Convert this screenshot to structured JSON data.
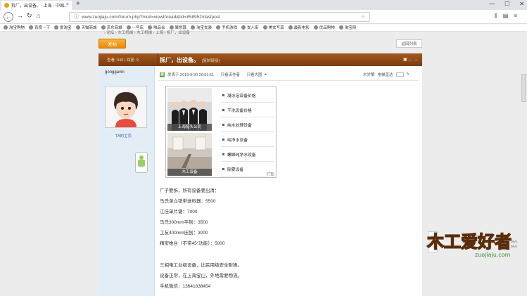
{
  "browser": {
    "tab_title": "拆厂，出设备。- 上海 - 中国...",
    "new_tab": "+",
    "url": "www.zuojiaju.com/forum.php?mod=viewthread&tid=858952#lastpost"
  },
  "bookmarks": [
    "淘宝购物",
    "百度一下",
    "爱淘宝",
    "天猫商城",
    "京东商城",
    "一号店",
    "唯品会",
    "聚划算",
    "淘宝女装",
    "手机游戏",
    "女人街",
    "美女写真",
    "最新电影",
    "优品购物",
    "淘宝网"
  ],
  "forum": {
    "breadcrumb": "› 论坛 › 木工机械 › 木工机械 › 上海 › 拆厂，出设备",
    "post_button": "发帖",
    "return_button": "返回列表",
    "stats": "查看: 949 | 回复: 9",
    "title": "拆厂，出设备。",
    "copy_link": "[复制链接]",
    "header_icons": "▣ ← →"
  },
  "author": {
    "name": "gonggavin",
    "follow": "TA的主页"
  },
  "post": {
    "posted_at": "发表于 2018-9-30 20:51:51",
    "only_author": "只看该作者",
    "big_image": "只看大图",
    "font_ctrl": "木労葉",
    "elec_ctrl": "电梯直达",
    "ad_caption_1": "上海猎头公司",
    "ad_caption_2": "木工设备",
    "ad_links": [
      "凝冰泡设备价格",
      "干洗设备价格",
      "纯水处理设备",
      "纯净水设备",
      "螺蛳纯净水设备",
      "除雾设备"
    ],
    "ad_tag": "广告",
    "lines": [
      "厂子要拆，所有设备要出清：",
      "马氏单立铣带送料器：5500",
      "江佳单片锯：7000",
      "马氏300mm平刨：3500",
      "工友400mm压刨：3000",
      "精密推台（不带45°功能）：5000",
      "",
      "三相电工业级设备，比民用级安全耐操。",
      "设备正常，在上海宝山，外地需要物流。",
      "手机微信：13641838454"
    ]
  },
  "logo_text": "木工爱好者",
  "logo_site": "zuojiaju.com",
  "net_speed": [
    "0K/s",
    "0K/s"
  ]
}
